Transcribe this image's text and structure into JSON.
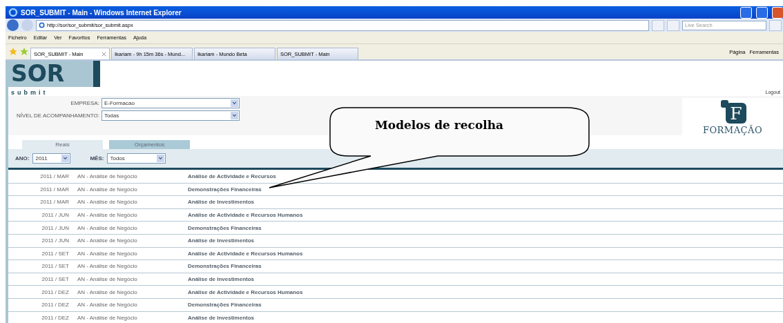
{
  "window": {
    "title": "SOR_SUBMIT - Main - Windows Internet Explorer"
  },
  "address": "http://sor/sor_submit/sor_submit.aspx",
  "search": {
    "placeholder": "Live Search"
  },
  "menu": [
    "Ficheiro",
    "Editar",
    "Ver",
    "Favoritos",
    "Ferramentas",
    "Ajuda"
  ],
  "browser_tabs": [
    {
      "label": "SOR_SUBMIT - Main",
      "selected": true
    },
    {
      "label": "Ikariam - 9h 15m 36s - Mund...",
      "selected": false
    },
    {
      "label": "Ikariam - Mundo Beta",
      "selected": false
    },
    {
      "label": "SOR_SUBMIT - Main",
      "selected": false
    }
  ],
  "command_bar": [
    "Página",
    "Ferramentas"
  ],
  "page": {
    "logo": "SOR",
    "subtitle": "submit",
    "logout": "Logout",
    "fields": [
      {
        "label": "EMPRESA:",
        "value": "E-Formacao"
      },
      {
        "label": "NÍVEL DE ACOMPANHAMENTO:",
        "value": "Todas"
      }
    ],
    "brand_letter": "F",
    "brand": "FORMAÇÃO",
    "tabs": [
      {
        "label": "Reais",
        "selected": true
      },
      {
        "label": "Orçamentos",
        "selected": false
      }
    ],
    "filters": [
      {
        "label": "ANO:",
        "value": "2011"
      },
      {
        "label": "MÊS:",
        "value": "Todos"
      }
    ],
    "rows": [
      {
        "period": "2011 / MAR",
        "area": "AN - Análise de Negócio",
        "model": "Análise de Actividade e Recursos"
      },
      {
        "period": "2011 / MAR",
        "area": "AN - Análise de Negócio",
        "model": "Demonstrações Financeiras"
      },
      {
        "period": "2011 / MAR",
        "area": "AN - Análise de Negócio",
        "model": "Análise de Investimentos"
      },
      {
        "period": "2011 / JUN",
        "area": "AN - Análise de Negócio",
        "model": "Análise de Actividade e Recursos Humanos"
      },
      {
        "period": "2011 / JUN",
        "area": "AN - Análise de Negócio",
        "model": "Demonstrações Financeiras"
      },
      {
        "period": "2011 / JUN",
        "area": "AN - Análise de Negócio",
        "model": "Análise de Investimentos"
      },
      {
        "period": "2011 / SET",
        "area": "AN - Análise de Negócio",
        "model": "Análise de Actividade e Recursos Humanos"
      },
      {
        "period": "2011 / SET",
        "area": "AN - Análise de Negócio",
        "model": "Demonstrações Financeiras"
      },
      {
        "period": "2011 / SET",
        "area": "AN - Análise de Negócio",
        "model": "Análise de Investimentos"
      },
      {
        "period": "2011 / DEZ",
        "area": "AN - Análise de Negócio",
        "model": "Análise de Actividade e Recursos Humanos"
      },
      {
        "period": "2011 / DEZ",
        "area": "AN - Análise de Negócio",
        "model": "Demonstrações Financeiras"
      },
      {
        "period": "2011 / DEZ",
        "area": "AN - Análise de Negócio",
        "model": "Análise de Investimentos"
      }
    ]
  },
  "callout": {
    "text": "Modelos de recolha"
  }
}
